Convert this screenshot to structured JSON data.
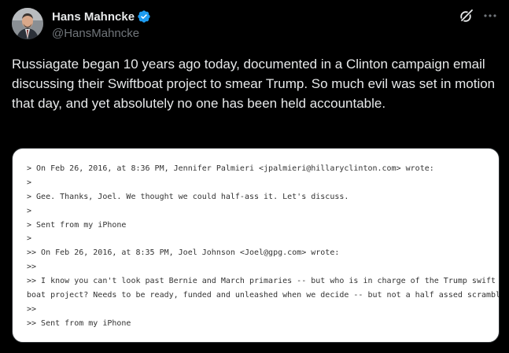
{
  "author": {
    "name": "Hans Mahncke",
    "handle": "@HansMahncke",
    "verified": true,
    "verified_color": "#1d9bf0"
  },
  "icons": {
    "grok": "grok-icon",
    "more": "more-icon",
    "verified": "verified-badge-icon"
  },
  "tweet": {
    "text": "Russiagate began 10 years ago today, documented in a Clinton campaign email discussing their Swiftboat project to smear Trump. So much evil was set in motion that day, and yet absolutely no one has been held accountable."
  },
  "email_image": {
    "lines": [
      "> On Feb 26, 2016, at 8:36 PM, Jennifer Palmieri <jpalmieri@hillaryclinton.com> wrote:",
      ">",
      "> Gee. Thanks, Joel. We thought we could half-ass it. Let's discuss.",
      ">",
      "> Sent from my iPhone",
      ">",
      ">> On Feb 26, 2016, at 8:35 PM, Joel Johnson <Joel@gpg.com> wrote:",
      ">>",
      ">> I know you can't look past Bernie and March primaries -- but who is in charge of the Trump swift",
      "boat project? Needs to be ready, funded and unleashed when we decide -- but not a half assed scramble.",
      ">>",
      ">> Sent from my iPhone"
    ]
  }
}
